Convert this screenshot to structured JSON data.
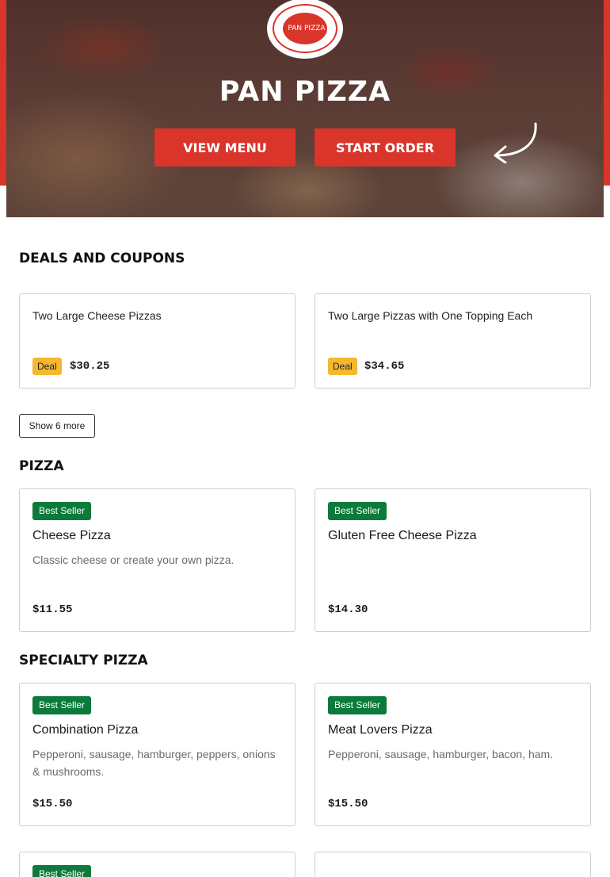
{
  "brand": {
    "name": "PAN PIZZA",
    "logo_text": "PAN PIZZA"
  },
  "hero": {
    "view_menu_label": "VIEW MENU",
    "start_order_label": "START ORDER"
  },
  "deals": {
    "title": "DEALS AND COUPONS",
    "items": [
      {
        "name": "Two Large Cheese Pizzas",
        "badge": "Deal",
        "price": "$30.25"
      },
      {
        "name": "Two Large Pizzas with One Topping Each",
        "badge": "Deal",
        "price": "$34.65"
      }
    ],
    "show_more_label": "Show 6 more"
  },
  "pizza": {
    "title": "PIZZA",
    "items": [
      {
        "badge": "Best Seller",
        "name": "Cheese Pizza",
        "description": "Classic cheese or create your own pizza.",
        "price": "$11.55"
      },
      {
        "badge": "Best Seller",
        "name": "Gluten Free Cheese Pizza",
        "description": "",
        "price": "$14.30"
      }
    ]
  },
  "specialty": {
    "title": "SPECIALTY PIZZA",
    "items": [
      {
        "badge": "Best Seller",
        "name": "Combination Pizza",
        "description": "Pepperoni, sausage, hamburger, peppers, onions & mushrooms.",
        "price": "$15.50"
      },
      {
        "badge": "Best Seller",
        "name": "Meat Lovers Pizza",
        "description": "Pepperoni, sausage, hamburger, bacon, ham.",
        "price": "$15.50"
      },
      {
        "badge": "Best Seller"
      }
    ]
  },
  "colors": {
    "brand_red": "#d9352b",
    "deal_yellow": "#f5b82e",
    "best_seller_green": "#0b7a3a"
  },
  "icons": {
    "logo": "pizza-logo-icon",
    "arrow": "curved-arrow-icon"
  }
}
